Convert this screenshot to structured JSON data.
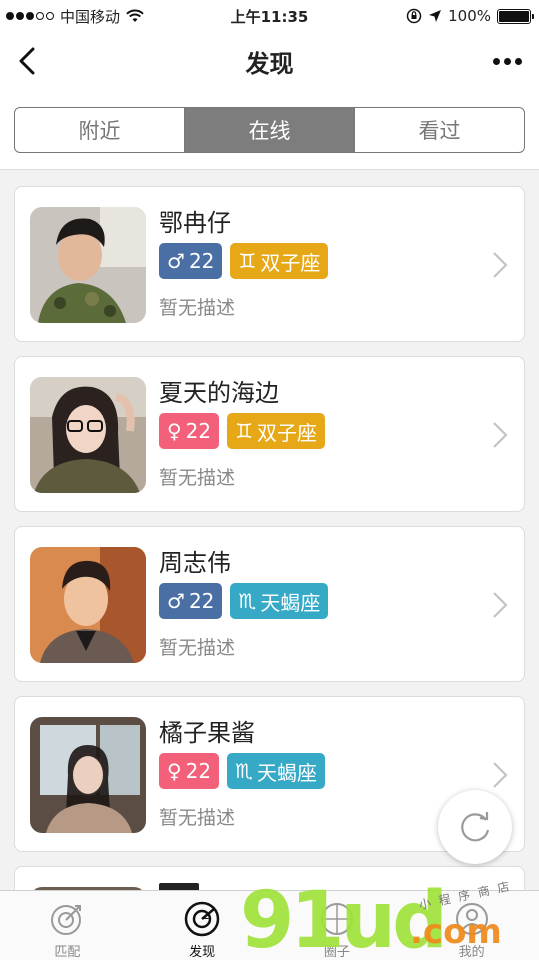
{
  "status_bar": {
    "carrier": "中国移动",
    "time": "上午11:35",
    "battery": "100%"
  },
  "navbar": {
    "title": "发现",
    "back_icon": "back-chevron-icon",
    "more_icon": "more-dots-icon"
  },
  "segments": [
    {
      "label": "附近",
      "active": false
    },
    {
      "label": "在线",
      "active": true
    },
    {
      "label": "看过",
      "active": false
    }
  ],
  "users": [
    {
      "name": "鄂冉仔",
      "gender_symbol": "♂",
      "age": "22",
      "gender": "male",
      "zodiac_symbol": "♊",
      "zodiac": "双子座",
      "zodiac_color": "#e6a817",
      "description": "暂无描述"
    },
    {
      "name": "夏天的海边",
      "gender_symbol": "♀",
      "age": "22",
      "gender": "female",
      "zodiac_symbol": "♊",
      "zodiac": "双子座",
      "zodiac_color": "#e6a817",
      "description": "暂无描述"
    },
    {
      "name": "周志伟",
      "gender_symbol": "♂",
      "age": "22",
      "gender": "male",
      "zodiac_symbol": "♏",
      "zodiac": "天蝎座",
      "zodiac_color": "#35a9c6",
      "description": "暂无描述"
    },
    {
      "name": "橘子果酱",
      "gender_symbol": "♀",
      "age": "22",
      "gender": "female",
      "zodiac_symbol": "♏",
      "zodiac": "天蝎座",
      "zodiac_color": "#35a9c6",
      "description": "暂无描述"
    }
  ],
  "refresh_icon": "refresh-icon",
  "tabbar": [
    {
      "label": "匹配",
      "icon": "target-icon",
      "active": false
    },
    {
      "label": "发现",
      "icon": "radar-icon",
      "active": true
    },
    {
      "label": "圈子",
      "icon": "circle-icon",
      "active": false
    },
    {
      "label": "我的",
      "icon": "user-icon",
      "active": false
    }
  ],
  "watermark": {
    "main": "91ud",
    "suffix": ".com",
    "tagline": "小程序商店"
  },
  "colors": {
    "male": "#4a6fa5",
    "female": "#f2607a",
    "segment_active": "#7d7d7d"
  }
}
